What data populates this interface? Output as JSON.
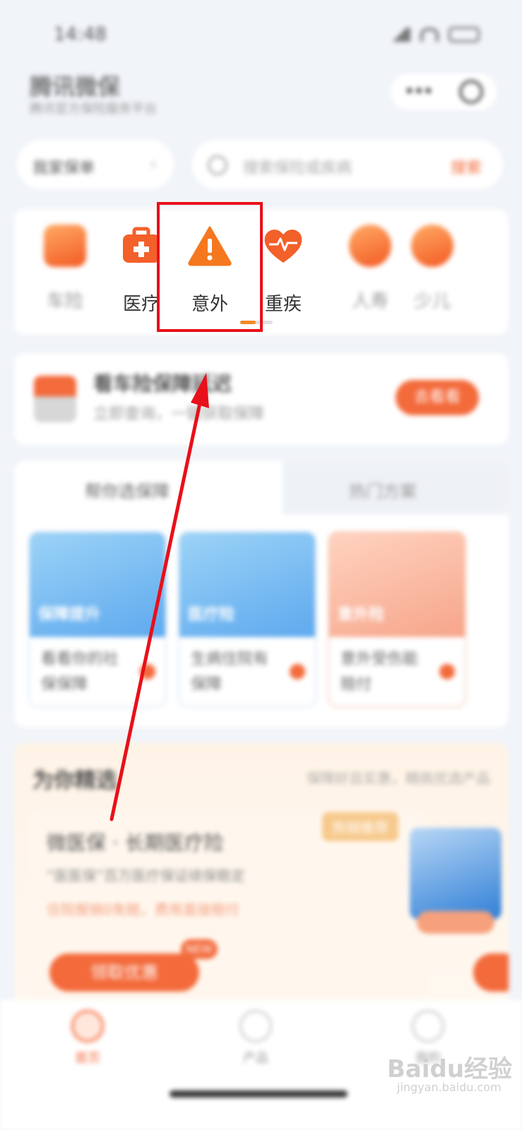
{
  "status_bar": {
    "time": "14:48"
  },
  "header": {
    "title": "腾讯微保",
    "subtitle": "腾讯官方保险服务平台"
  },
  "selector": {
    "label": "我家保单"
  },
  "search": {
    "placeholder": "搜索保险或疾病",
    "action": "搜索"
  },
  "categories": [
    {
      "label": "车险",
      "icon": "car-insurance-icon",
      "dim": true
    },
    {
      "label": "医疗",
      "icon": "medical-kit-icon",
      "dim": false
    },
    {
      "label": "意外",
      "icon": "warning-triangle-icon",
      "dim": false,
      "highlighted": true
    },
    {
      "label": "重疾",
      "icon": "heart-pulse-icon",
      "dim": false
    },
    {
      "label": "人寿",
      "icon": "shield-icon",
      "dim": true
    },
    {
      "label": "少儿",
      "icon": "child-icon",
      "dim": true
    }
  ],
  "promo": {
    "title": "看车险保障延迟",
    "subtitle": "立即查询，一键获取保障",
    "button": "去看看"
  },
  "tabs": {
    "active": "帮你选保障",
    "inactive": "热门方案"
  },
  "product_cards": [
    {
      "tag": "保障提升",
      "desc": "看看你的社保保障",
      "theme": "blue"
    },
    {
      "tag": "医疗险",
      "desc": "生病住院有保障",
      "theme": "blue"
    },
    {
      "tag": "意外险",
      "desc": "意外受伤能赔付",
      "theme": "orange"
    }
  ],
  "recommend": {
    "heading": "为你精选",
    "heading_right": "保障好且实惠，精挑优选产品",
    "badge": "热销推荐",
    "title": "微医保 · 长期医疗险",
    "desc": "“医医保”百万医疗保证续保稳定",
    "warn": "住院报销0免赔，费用直接赔付",
    "button": "领取优惠",
    "new_tag": "NEW"
  },
  "bottom_nav": [
    {
      "label": "首页",
      "active": true
    },
    {
      "label": "产品",
      "active": false
    },
    {
      "label": "我的",
      "active": false
    }
  ],
  "watermark": {
    "text": "Baidu经验",
    "sub": "jingyan.baidu.com"
  },
  "colors": {
    "accent": "#f36a3b",
    "highlight_box": "#e8101a"
  }
}
